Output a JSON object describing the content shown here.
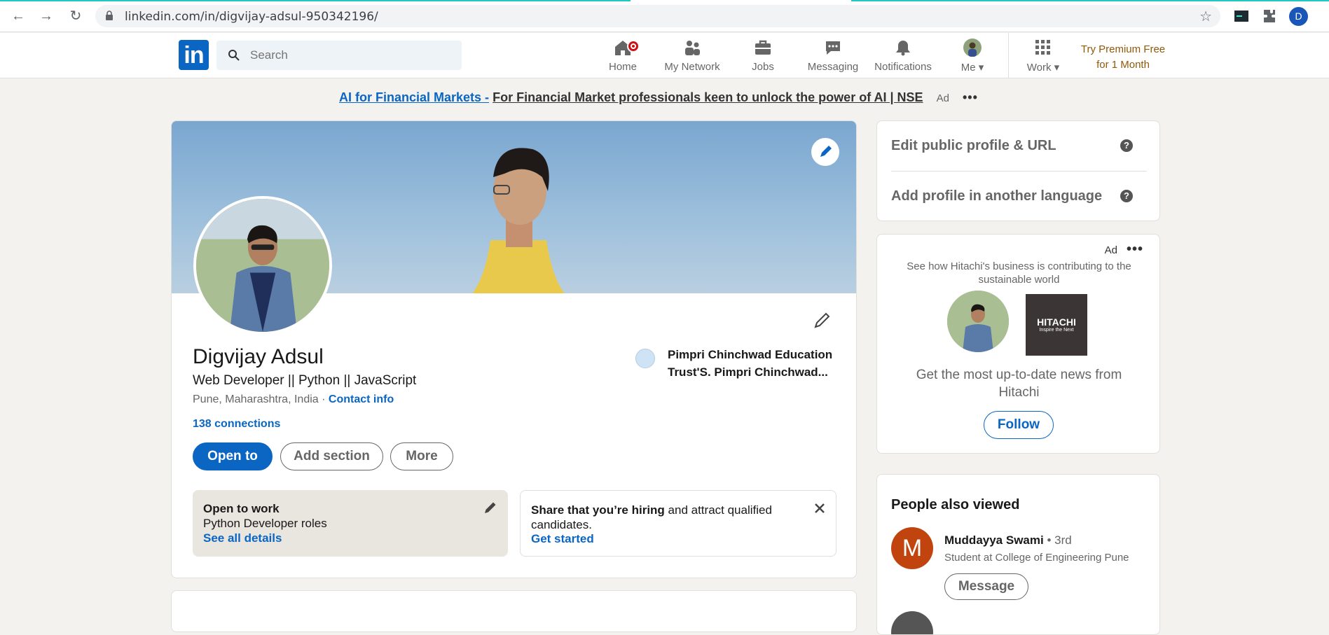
{
  "browser": {
    "url": "linkedin.com/in/digvijay-adsul-950342196/",
    "profile_initial": "D"
  },
  "header": {
    "search_placeholder": "Search",
    "nav": [
      {
        "label": "Home",
        "icon": "home-icon"
      },
      {
        "label": "My Network",
        "icon": "network-icon"
      },
      {
        "label": "Jobs",
        "icon": "briefcase-icon"
      },
      {
        "label": "Messaging",
        "icon": "messaging-icon"
      },
      {
        "label": "Notifications",
        "icon": "bell-icon"
      },
      {
        "label": "Me",
        "icon": "avatar"
      },
      {
        "label": "Work",
        "icon": "grid-icon"
      }
    ],
    "premium_line1": "Try Premium Free",
    "premium_line2": "for 1 Month"
  },
  "ad_banner": {
    "link": "AI for Financial Markets -",
    "text": "For Financial Market professionals keen to unlock the power of AI | NSE",
    "tag": "Ad"
  },
  "profile": {
    "name": "Digvijay Adsul",
    "headline": "Web Developer || Python || JavaScript",
    "location": "Pune, Maharashtra, India",
    "location_sep": "·",
    "contact_info": "Contact info",
    "connections": "138 connections",
    "education": "Pimpri Chinchwad Education Trust'S. Pimpri Chinchwad...",
    "buttons": {
      "open_to": "Open to",
      "add_section": "Add section",
      "more": "More"
    },
    "open_to_work": {
      "title": "Open to work",
      "roles": "Python Developer roles",
      "link": "See all details"
    },
    "hiring": {
      "bold": "Share that you’re hiring",
      "rest": "and attract qualified candidates.",
      "link": "Get started"
    }
  },
  "sidebar": {
    "edit_url": "Edit public profile & URL",
    "add_language": "Add profile in another language",
    "ad": {
      "tag": "Ad",
      "subtitle": "See how Hitachi's business is contributing to the sustainable world",
      "logo_text": "HITACHI",
      "logo_tagline": "Inspire the Next",
      "message": "Get the most up-to-date news from Hitachi",
      "follow": "Follow"
    },
    "people_also_viewed": {
      "title": "People also viewed",
      "people": [
        {
          "initial": "M",
          "name": "Muddayya Swami",
          "degree": "• 3rd",
          "desc": "Student at College of Engineering Pune",
          "action": "Message"
        }
      ]
    }
  },
  "colors": {
    "brand": "#0a66c2",
    "premium": "#915907",
    "background": "#f3f2ef"
  }
}
